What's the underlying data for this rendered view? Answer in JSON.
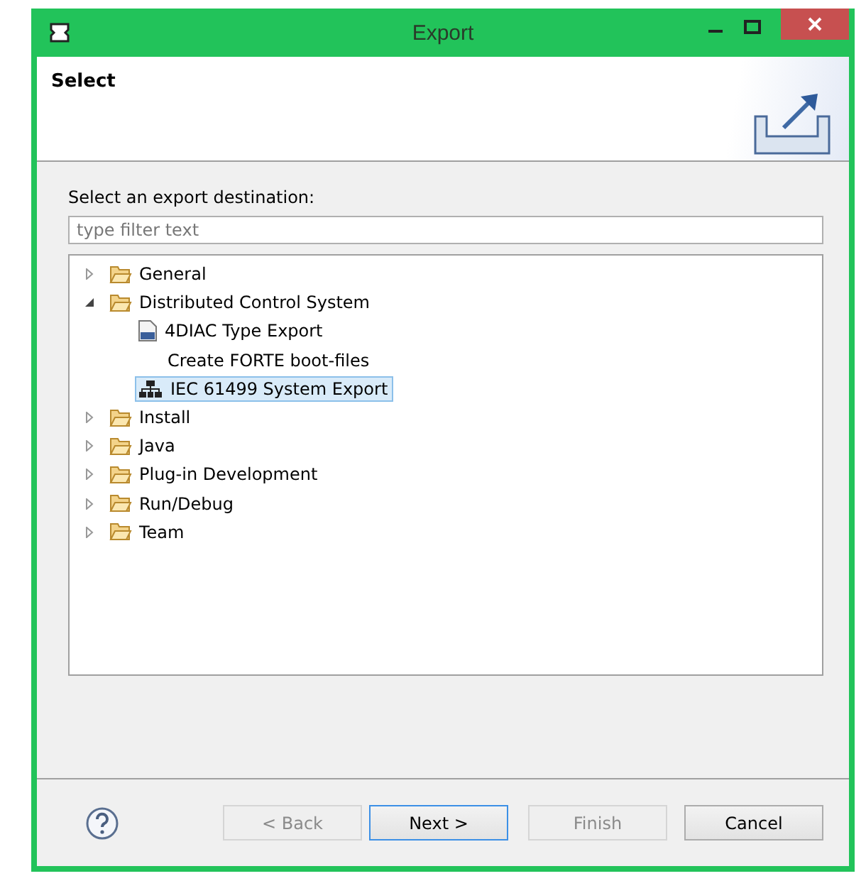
{
  "window": {
    "title": "Export"
  },
  "header": {
    "title": "Select"
  },
  "prompt": "Select an export destination:",
  "filter": {
    "placeholder": "type filter text"
  },
  "tree": [
    {
      "label": "General",
      "kind": "folder",
      "expanded": false,
      "selected": false
    },
    {
      "label": "Distributed Control System",
      "kind": "folder",
      "expanded": true,
      "selected": false,
      "children": [
        {
          "label": "4DIAC Type Export",
          "kind": "file",
          "selected": false
        },
        {
          "label": "Create FORTE boot-files",
          "kind": "blank",
          "selected": false
        },
        {
          "label": "IEC 61499 System Export",
          "kind": "system",
          "selected": true
        }
      ]
    },
    {
      "label": "Install",
      "kind": "folder",
      "expanded": false,
      "selected": false
    },
    {
      "label": "Java",
      "kind": "folder",
      "expanded": false,
      "selected": false
    },
    {
      "label": "Plug-in Development",
      "kind": "folder",
      "expanded": false,
      "selected": false
    },
    {
      "label": "Run/Debug",
      "kind": "folder",
      "expanded": false,
      "selected": false
    },
    {
      "label": "Team",
      "kind": "folder",
      "expanded": false,
      "selected": false
    }
  ],
  "buttons": [
    {
      "label": "< Back",
      "disabled": true,
      "default": false
    },
    {
      "label": "Next >",
      "disabled": false,
      "default": true
    },
    {
      "label": "Finish",
      "disabled": true,
      "default": false
    },
    {
      "label": "Cancel",
      "disabled": false,
      "default": false
    }
  ]
}
